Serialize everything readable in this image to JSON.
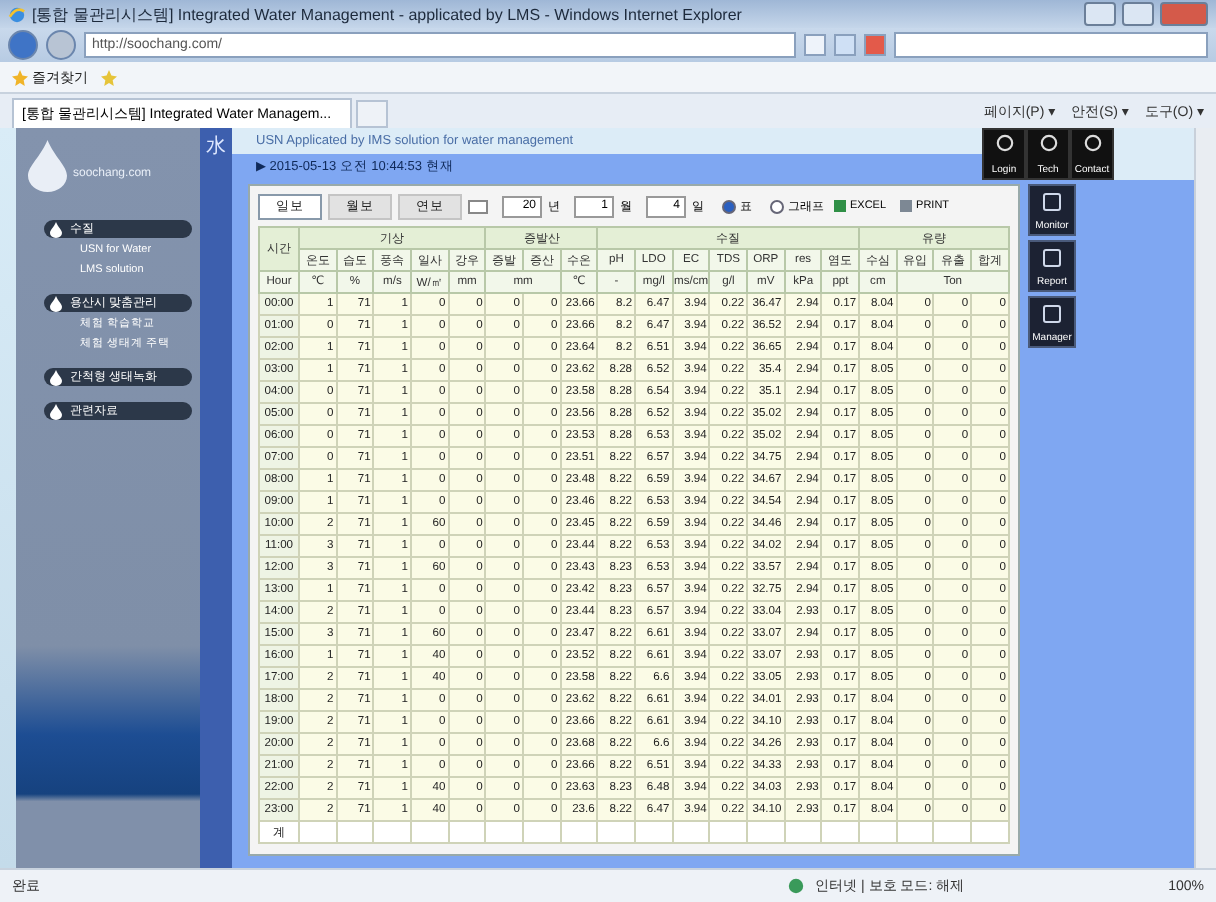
{
  "window": {
    "title": "[통합 물관리시스템] Integrated Water Management - applicated by LMS - Windows Internet Explorer"
  },
  "address_bar": {
    "url": "http://soochang.com/"
  },
  "favorites_bar": {
    "label": "즐겨찾기"
  },
  "browser_tabs": [
    {
      "label": "[통합 물관리시스템] Integrated Water Managem...",
      "selected": true
    }
  ],
  "command_bar": [
    "페이지(P) ▾",
    "안전(S) ▾",
    "도구(O) ▾"
  ],
  "page": {
    "tagline": "USN Applicated by IMS solution for water management",
    "logo_text": "soochang.com",
    "side_banner": "水",
    "top_links": [
      "Login",
      "Tech",
      "Contact"
    ],
    "side_links": [
      "Monitor",
      "Report",
      "Manager"
    ],
    "menu": [
      {
        "label": "수질",
        "children": [
          {
            "label": "USN for Water"
          },
          {
            "label": "LMS solution"
          }
        ]
      },
      {
        "label": "용산시 맞춤관리",
        "children": [
          {
            "label": "체험 학습학교"
          },
          {
            "label": "체험 생태계 주택"
          }
        ]
      },
      {
        "label": "간척형 생태녹화"
      },
      {
        "label": "관련자료"
      }
    ],
    "timestamp": "▶ 2015-05-13 오전 10:44:53 현재"
  },
  "report": {
    "tabs": [
      {
        "label": "일보",
        "selected": true
      },
      {
        "label": "월보",
        "selected": false
      },
      {
        "label": "연보",
        "selected": false
      }
    ],
    "date": [
      {
        "value": "20",
        "unit": "년"
      },
      {
        "value": "1",
        "unit": "월"
      },
      {
        "value": "4",
        "unit": "일"
      }
    ],
    "view_options": [
      {
        "label": "표",
        "selected": true
      },
      {
        "label": "그래프",
        "selected": false
      }
    ],
    "buttons": [
      "EXCEL",
      "PRINT"
    ],
    "table": {
      "time_header": "시간",
      "time_unit": "Hour",
      "groups": [
        {
          "label": "기상",
          "columns": [
            {
              "name": "온도",
              "unit": "℃"
            },
            {
              "name": "습도",
              "unit": "%"
            },
            {
              "name": "풍속",
              "unit": "m/s"
            },
            {
              "name": "일사",
              "unit": "W/㎡"
            },
            {
              "name": "강우",
              "unit": "mm"
            }
          ]
        },
        {
          "label": "증발산",
          "columns": [
            {
              "name": "증발",
              "unit": "mm"
            },
            {
              "name": "증산"
            },
            {
              "name": "수온",
              "unit": "℃"
            }
          ]
        },
        {
          "label": "수질",
          "columns": [
            {
              "name": "pH",
              "unit": "-"
            },
            {
              "name": "LDO",
              "unit": "mg/l"
            },
            {
              "name": "EC",
              "unit": "ms/cm"
            },
            {
              "name": "TDS",
              "unit": "g/l"
            },
            {
              "name": "ORP",
              "unit": "mV"
            },
            {
              "name": "res",
              "unit": "kPa"
            },
            {
              "name": "염도",
              "unit": "ppt"
            }
          ]
        },
        {
          "label": "유량",
          "columns": [
            {
              "name": "수심",
              "unit": "cm"
            },
            {
              "name": "유입",
              "unit": "Ton"
            },
            {
              "name": "유출"
            },
            {
              "name": "합계"
            }
          ]
        }
      ],
      "rows": [
        {
          "time": "00:00",
          "values": [
            "1",
            "71",
            "1",
            "0",
            "0",
            "0",
            "0",
            "23.66",
            "8.2",
            "6.47",
            "3.94",
            "0.22",
            "36.47",
            "2.94",
            "0.17",
            "8.04",
            "0",
            "0",
            "0"
          ]
        },
        {
          "time": "01:00",
          "values": [
            "0",
            "71",
            "1",
            "0",
            "0",
            "0",
            "0",
            "23.66",
            "8.2",
            "6.47",
            "3.94",
            "0.22",
            "36.52",
            "2.94",
            "0.17",
            "8.04",
            "0",
            "0",
            "0"
          ]
        },
        {
          "time": "02:00",
          "values": [
            "1",
            "71",
            "1",
            "0",
            "0",
            "0",
            "0",
            "23.64",
            "8.2",
            "6.51",
            "3.94",
            "0.22",
            "36.65",
            "2.94",
            "0.17",
            "8.04",
            "0",
            "0",
            "0"
          ]
        },
        {
          "time": "03:00",
          "values": [
            "1",
            "71",
            "1",
            "0",
            "0",
            "0",
            "0",
            "23.62",
            "8.28",
            "6.52",
            "3.94",
            "0.22",
            "35.4",
            "2.94",
            "0.17",
            "8.05",
            "0",
            "0",
            "0"
          ]
        },
        {
          "time": "04:00",
          "values": [
            "0",
            "71",
            "1",
            "0",
            "0",
            "0",
            "0",
            "23.58",
            "8.28",
            "6.54",
            "3.94",
            "0.22",
            "35.1",
            "2.94",
            "0.17",
            "8.05",
            "0",
            "0",
            "0"
          ]
        },
        {
          "time": "05:00",
          "values": [
            "0",
            "71",
            "1",
            "0",
            "0",
            "0",
            "0",
            "23.56",
            "8.28",
            "6.52",
            "3.94",
            "0.22",
            "35.02",
            "2.94",
            "0.17",
            "8.05",
            "0",
            "0",
            "0"
          ]
        },
        {
          "time": "06:00",
          "values": [
            "0",
            "71",
            "1",
            "0",
            "0",
            "0",
            "0",
            "23.53",
            "8.28",
            "6.53",
            "3.94",
            "0.22",
            "35.02",
            "2.94",
            "0.17",
            "8.05",
            "0",
            "0",
            "0"
          ]
        },
        {
          "time": "07:00",
          "values": [
            "0",
            "71",
            "1",
            "0",
            "0",
            "0",
            "0",
            "23.51",
            "8.22",
            "6.57",
            "3.94",
            "0.22",
            "34.75",
            "2.94",
            "0.17",
            "8.05",
            "0",
            "0",
            "0"
          ]
        },
        {
          "time": "08:00",
          "values": [
            "1",
            "71",
            "1",
            "0",
            "0",
            "0",
            "0",
            "23.48",
            "8.22",
            "6.59",
            "3.94",
            "0.22",
            "34.67",
            "2.94",
            "0.17",
            "8.05",
            "0",
            "0",
            "0"
          ]
        },
        {
          "time": "09:00",
          "values": [
            "1",
            "71",
            "1",
            "0",
            "0",
            "0",
            "0",
            "23.46",
            "8.22",
            "6.53",
            "3.94",
            "0.22",
            "34.54",
            "2.94",
            "0.17",
            "8.05",
            "0",
            "0",
            "0"
          ]
        },
        {
          "time": "10:00",
          "values": [
            "2",
            "71",
            "1",
            "60",
            "0",
            "0",
            "0",
            "23.45",
            "8.22",
            "6.59",
            "3.94",
            "0.22",
            "34.46",
            "2.94",
            "0.17",
            "8.05",
            "0",
            "0",
            "0"
          ]
        },
        {
          "time": "11:00",
          "values": [
            "3",
            "71",
            "1",
            "0",
            "0",
            "0",
            "0",
            "23.44",
            "8.22",
            "6.53",
            "3.94",
            "0.22",
            "34.02",
            "2.94",
            "0.17",
            "8.05",
            "0",
            "0",
            "0"
          ]
        },
        {
          "time": "12:00",
          "values": [
            "3",
            "71",
            "1",
            "60",
            "0",
            "0",
            "0",
            "23.43",
            "8.23",
            "6.53",
            "3.94",
            "0.22",
            "33.57",
            "2.94",
            "0.17",
            "8.05",
            "0",
            "0",
            "0"
          ]
        },
        {
          "time": "13:00",
          "values": [
            "1",
            "71",
            "1",
            "0",
            "0",
            "0",
            "0",
            "23.42",
            "8.23",
            "6.57",
            "3.94",
            "0.22",
            "32.75",
            "2.94",
            "0.17",
            "8.05",
            "0",
            "0",
            "0"
          ]
        },
        {
          "time": "14:00",
          "values": [
            "2",
            "71",
            "1",
            "0",
            "0",
            "0",
            "0",
            "23.44",
            "8.23",
            "6.57",
            "3.94",
            "0.22",
            "33.04",
            "2.93",
            "0.17",
            "8.05",
            "0",
            "0",
            "0"
          ]
        },
        {
          "time": "15:00",
          "values": [
            "3",
            "71",
            "1",
            "60",
            "0",
            "0",
            "0",
            "23.47",
            "8.22",
            "6.61",
            "3.94",
            "0.22",
            "33.07",
            "2.94",
            "0.17",
            "8.05",
            "0",
            "0",
            "0"
          ]
        },
        {
          "time": "16:00",
          "values": [
            "1",
            "71",
            "1",
            "40",
            "0",
            "0",
            "0",
            "23.52",
            "8.22",
            "6.61",
            "3.94",
            "0.22",
            "33.07",
            "2.93",
            "0.17",
            "8.05",
            "0",
            "0",
            "0"
          ]
        },
        {
          "time": "17:00",
          "values": [
            "2",
            "71",
            "1",
            "40",
            "0",
            "0",
            "0",
            "23.58",
            "8.22",
            "6.6",
            "3.94",
            "0.22",
            "33.05",
            "2.93",
            "0.17",
            "8.05",
            "0",
            "0",
            "0"
          ]
        },
        {
          "time": "18:00",
          "values": [
            "2",
            "71",
            "1",
            "0",
            "0",
            "0",
            "0",
            "23.62",
            "8.22",
            "6.61",
            "3.94",
            "0.22",
            "34.01",
            "2.93",
            "0.17",
            "8.04",
            "0",
            "0",
            "0"
          ]
        },
        {
          "time": "19:00",
          "values": [
            "2",
            "71",
            "1",
            "0",
            "0",
            "0",
            "0",
            "23.66",
            "8.22",
            "6.61",
            "3.94",
            "0.22",
            "34.10",
            "2.93",
            "0.17",
            "8.04",
            "0",
            "0",
            "0"
          ]
        },
        {
          "time": "20:00",
          "values": [
            "2",
            "71",
            "1",
            "0",
            "0",
            "0",
            "0",
            "23.68",
            "8.22",
            "6.6",
            "3.94",
            "0.22",
            "34.26",
            "2.93",
            "0.17",
            "8.04",
            "0",
            "0",
            "0"
          ]
        },
        {
          "time": "21:00",
          "values": [
            "2",
            "71",
            "1",
            "0",
            "0",
            "0",
            "0",
            "23.66",
            "8.22",
            "6.51",
            "3.94",
            "0.22",
            "34.33",
            "2.93",
            "0.17",
            "8.04",
            "0",
            "0",
            "0"
          ]
        },
        {
          "time": "22:00",
          "values": [
            "2",
            "71",
            "1",
            "40",
            "0",
            "0",
            "0",
            "23.63",
            "8.23",
            "6.48",
            "3.94",
            "0.22",
            "34.03",
            "2.93",
            "0.17",
            "8.04",
            "0",
            "0",
            "0"
          ]
        },
        {
          "time": "23:00",
          "values": [
            "2",
            "71",
            "1",
            "40",
            "0",
            "0",
            "0",
            "23.6",
            "8.22",
            "6.47",
            "3.94",
            "0.22",
            "34.10",
            "2.93",
            "0.17",
            "8.04",
            "0",
            "0",
            "0"
          ]
        },
        {
          "time": "계"
        }
      ]
    }
  },
  "status_bar": {
    "text": "완료",
    "zone": "인터넷 | 보호 모드: 해제",
    "zoom": "100%"
  }
}
